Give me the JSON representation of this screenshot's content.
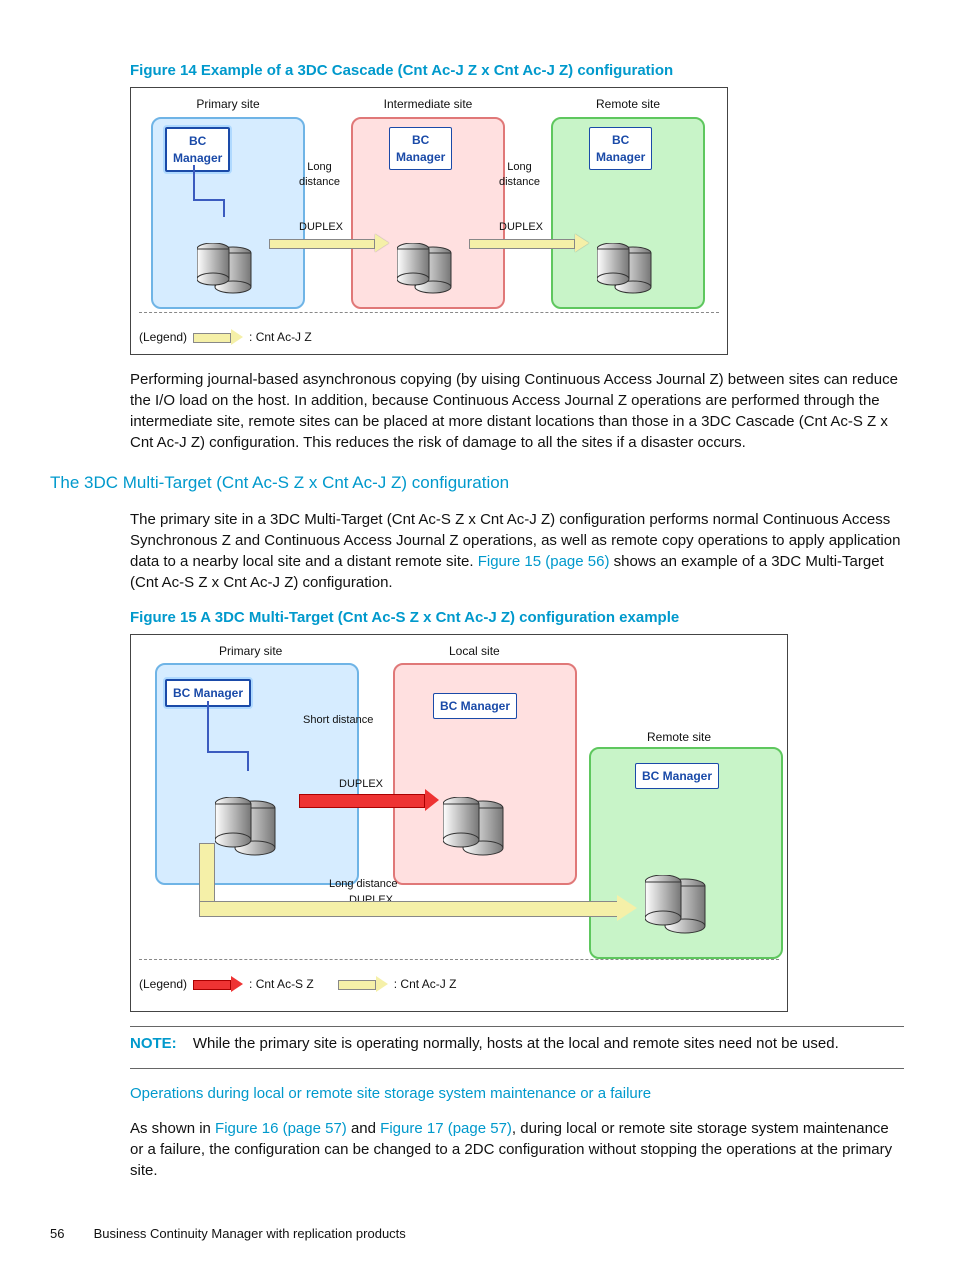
{
  "figure14": {
    "caption": "Figure 14 Example of a 3DC Cascade (Cnt Ac-J Z x Cnt Ac-J Z) configuration",
    "sites": {
      "primary": "Primary site",
      "intermediate": "Intermediate site",
      "remote": "Remote site"
    },
    "bc": "BC\nManager",
    "long_distance": "Long\ndistance",
    "duplex": "DUPLEX",
    "legend_label": "(Legend)",
    "legend_item": ": Cnt Ac-J Z"
  },
  "para_after_fig14": "Performing journal-based asynchronous copying (by uising Continuous Access Journal Z) between sites can reduce the I/O load on the host. In addition, because Continuous Access Journal Z operations are performed through the intermediate site, remote sites can be placed at more distant locations than those in a 3DC Cascade (Cnt Ac-S Z x Cnt Ac-J Z) configuration. This reduces the risk of damage to all the sites if a disaster occurs.",
  "section_heading": "The 3DC Multi-Target (Cnt Ac-S Z x Cnt Ac-J Z) configuration",
  "para_multitarget_a": "The primary site in a 3DC Multi-Target (Cnt Ac-S Z x Cnt Ac-J Z) configuration performs normal Continuous Access Synchronous Z and Continuous Access Journal Z operations, as well as remote copy operations to apply application data to a nearby local site and a distant remote site. ",
  "link_fig15": "Figure 15 (page 56)",
  "para_multitarget_b": " shows an example of a 3DC Multi-Target (Cnt Ac-S Z x Cnt Ac-J Z) configuration.",
  "figure15": {
    "caption": "Figure 15 A 3DC Multi-Target (Cnt Ac-S Z x Cnt Ac-J Z) configuration example",
    "sites": {
      "primary": "Primary site",
      "local": "Local site",
      "remote": "Remote site"
    },
    "bc_primary": "BC Manager",
    "bc_other": "BC Manager",
    "short_distance": "Short distance",
    "long_distance": "Long distance",
    "duplex": "DUPLEX",
    "legend_label": "(Legend)",
    "legend_red": ": Cnt Ac-S Z",
    "legend_yellow": ": Cnt Ac-J Z"
  },
  "note": {
    "label": "NOTE:",
    "text": "While the primary site is operating normally, hosts at the local and remote sites need not be used."
  },
  "subheading_ops": "Operations during local or remote site storage system maintenance or a failure",
  "ops_para_a": "As shown in ",
  "link_fig16": "Figure 16 (page 57)",
  "ops_para_b": " and ",
  "link_fig17": "Figure 17 (page 57)",
  "ops_para_c": ", during local or remote site storage system maintenance or a failure, the configuration can be changed to a 2DC configuration without stopping the operations at the primary site.",
  "footer": {
    "page": "56",
    "title": "Business Continuity Manager with replication products"
  }
}
